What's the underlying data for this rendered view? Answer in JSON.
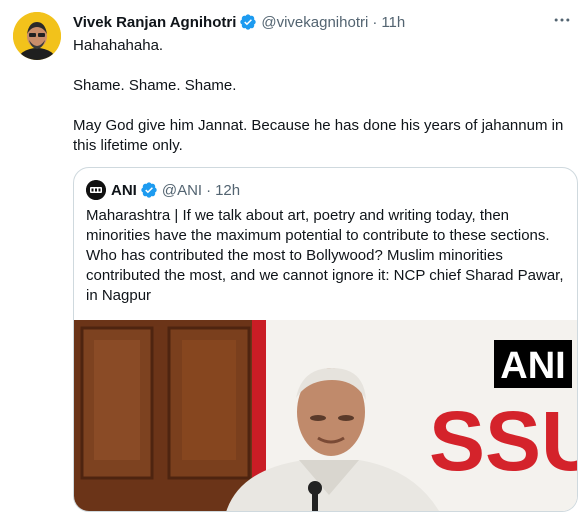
{
  "tweet": {
    "author_name": "Vivek Ranjan Agnihotri",
    "handle": "@vivekagnihotri",
    "separator": "·",
    "time": "11h",
    "lines": [
      "Hahahahaha.",
      "Shame. Shame. Shame.",
      "May God give him Jannat. Because he has done his years of jahannum in this lifetime only."
    ]
  },
  "quote": {
    "author_name": "ANI",
    "handle": "@ANI",
    "separator": "·",
    "time": "12h",
    "text": "Maharashtra | If we talk about art, poetry and writing today, then minorities have the maximum potential to contribute to these sections. Who has contributed the most to Bollywood? Muslim minorities contributed the most, and we cannot ignore it: NCP chief Sharad Pawar, in Nagpur",
    "media": {
      "watermark": "ANI",
      "backdrop_text": "SSU"
    }
  },
  "colors": {
    "verified": "#1d9bf0",
    "secondary_text": "#536471",
    "border": "#cfd9de",
    "backdrop_red": "#d4232b",
    "wood": "#7a3f1d"
  },
  "icons": {
    "verified": "verified-badge-icon",
    "more": "more-options-icon"
  }
}
